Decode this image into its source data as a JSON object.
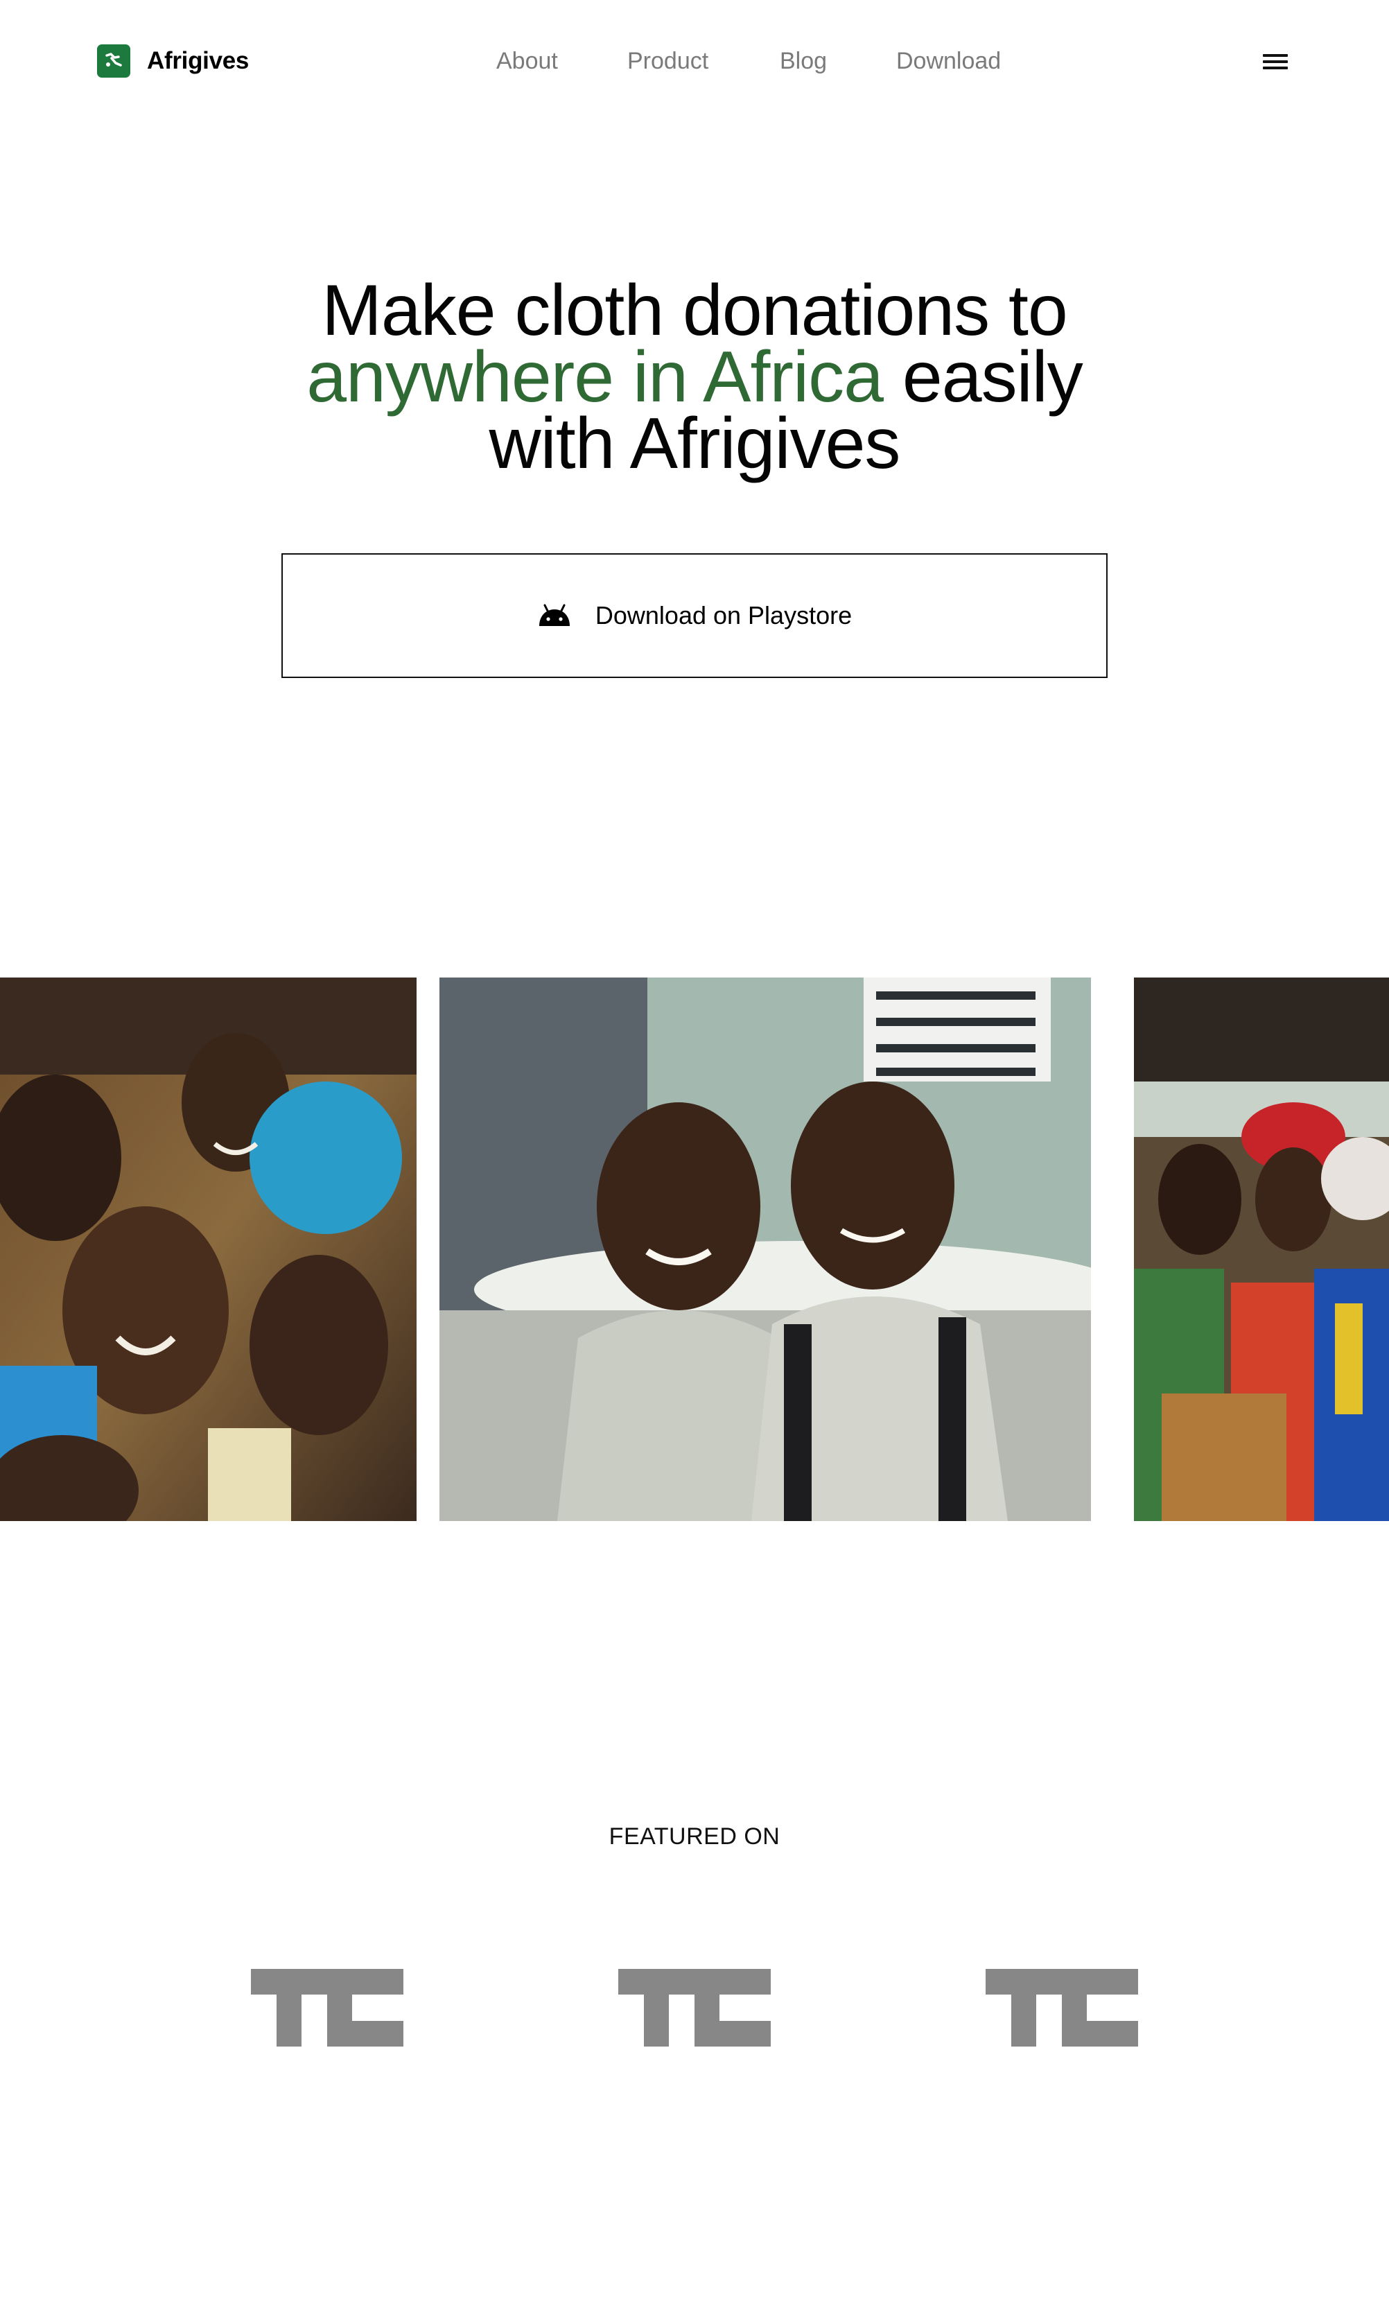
{
  "header": {
    "brand_name": "Afrigives",
    "nav": [
      {
        "label": "About"
      },
      {
        "label": "Product"
      },
      {
        "label": "Blog"
      },
      {
        "label": "Download"
      }
    ]
  },
  "hero": {
    "title_part1": "Make cloth donations to",
    "title_accent": "anywhere in Africa",
    "title_part2": "easily",
    "title_part3": "with Afrigives",
    "accent_color": "#2f6a35",
    "cta_label": "Download on Playstore",
    "cta_icon": "android-icon"
  },
  "gallery": {
    "photos": [
      {
        "subject": "group of smiling children"
      },
      {
        "subject": "two smiling schoolboys in checked shirts"
      },
      {
        "subject": "women in colorful wraps"
      }
    ]
  },
  "featured": {
    "label": "FEATURED ON",
    "logos": [
      {
        "icon": "techcrunch-logo"
      },
      {
        "icon": "techcrunch-logo"
      },
      {
        "icon": "techcrunch-logo"
      }
    ]
  },
  "colors": {
    "brand_green": "#1d7a3e",
    "nav_text": "#7a7a7a",
    "logo_gray": "#878787"
  }
}
